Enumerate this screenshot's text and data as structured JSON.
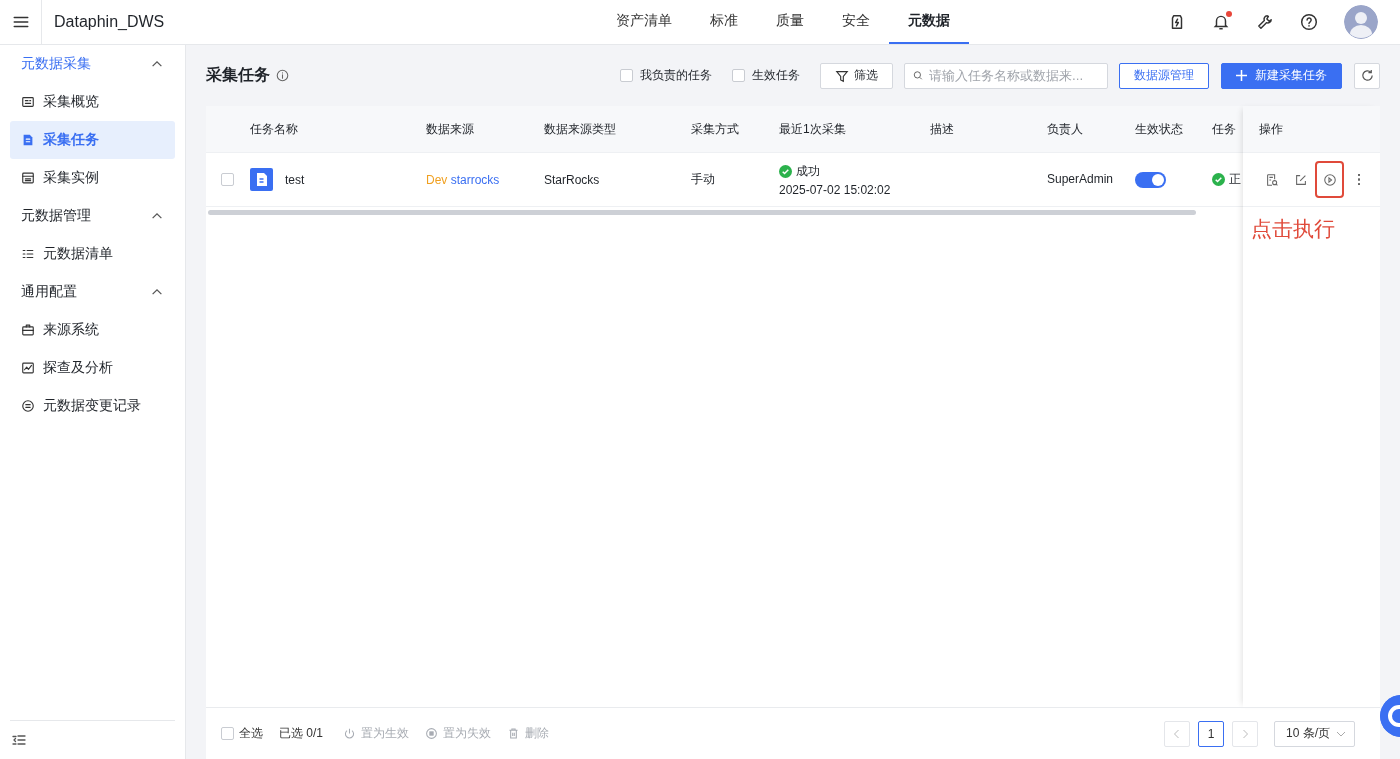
{
  "topbar": {
    "app_name": "Dataphin_DWS",
    "nav": [
      {
        "label": "资产清单",
        "selected": false
      },
      {
        "label": "标准",
        "selected": false
      },
      {
        "label": "质量",
        "selected": false
      },
      {
        "label": "安全",
        "selected": false
      },
      {
        "label": "元数据",
        "selected": true
      }
    ],
    "notification": true
  },
  "sidebar": {
    "groups": [
      {
        "label": "元数据采集",
        "expanded": true,
        "items": [
          {
            "label": "采集概览",
            "selected": false
          },
          {
            "label": "采集任务",
            "selected": true
          },
          {
            "label": "采集实例",
            "selected": false
          }
        ]
      },
      {
        "label": "元数据管理",
        "expanded": true,
        "items": [
          {
            "label": "元数据清单",
            "selected": false
          }
        ]
      },
      {
        "label": "通用配置",
        "expanded": true,
        "items": [
          {
            "label": "来源系统",
            "selected": false
          },
          {
            "label": "探查及分析",
            "selected": false
          },
          {
            "label": "元数据变更记录",
            "selected": false
          }
        ]
      }
    ]
  },
  "page": {
    "title": "采集任务",
    "filters": [
      {
        "label": "我负责的任务",
        "checked": false
      },
      {
        "label": "生效任务",
        "checked": false
      }
    ],
    "filter_button": "筛选",
    "search": {
      "placeholder": "请输入任务名称或数据来..."
    },
    "buttons": [
      {
        "label": "数据源管理",
        "kind": "outline"
      },
      {
        "label": "新建采集任务",
        "kind": "primary"
      }
    ]
  },
  "table": {
    "columns": [
      "任务名称",
      "数据来源",
      "数据来源类型",
      "采集方式",
      "最近1次采集",
      "描述",
      "负责人",
      "生效状态",
      "任务"
    ],
    "actions_column": "操作",
    "rows": [
      {
        "checked": false,
        "name": "test",
        "source_env": "Dev",
        "source": "starrocks",
        "source_type": "StarRocks",
        "method": "手动",
        "last_status": "成功",
        "last_time": "2025-07-02 15:02:02",
        "owner": "SuperAdmin",
        "enabled": true,
        "task_status": "正",
        "actions": [
          {
            "kind": "view",
            "highlighted": false
          },
          {
            "kind": "edit",
            "highlighted": false
          },
          {
            "kind": "run",
            "highlighted": true
          },
          {
            "kind": "more",
            "highlighted": false
          }
        ]
      }
    ]
  },
  "annotation": {
    "text": "点击执行"
  },
  "footer": {
    "select_all": {
      "label": "全选",
      "checked": false
    },
    "selected_count": "已选 0/1",
    "actions": [
      {
        "label": "置为生效",
        "kind": "power",
        "disabled": true
      },
      {
        "label": "置为失效",
        "kind": "stop",
        "disabled": true
      },
      {
        "label": "删除",
        "kind": "delete",
        "disabled": true
      }
    ],
    "pages": [
      {
        "label": "1",
        "selected": true
      }
    ],
    "page_size": "10 条/页"
  }
}
